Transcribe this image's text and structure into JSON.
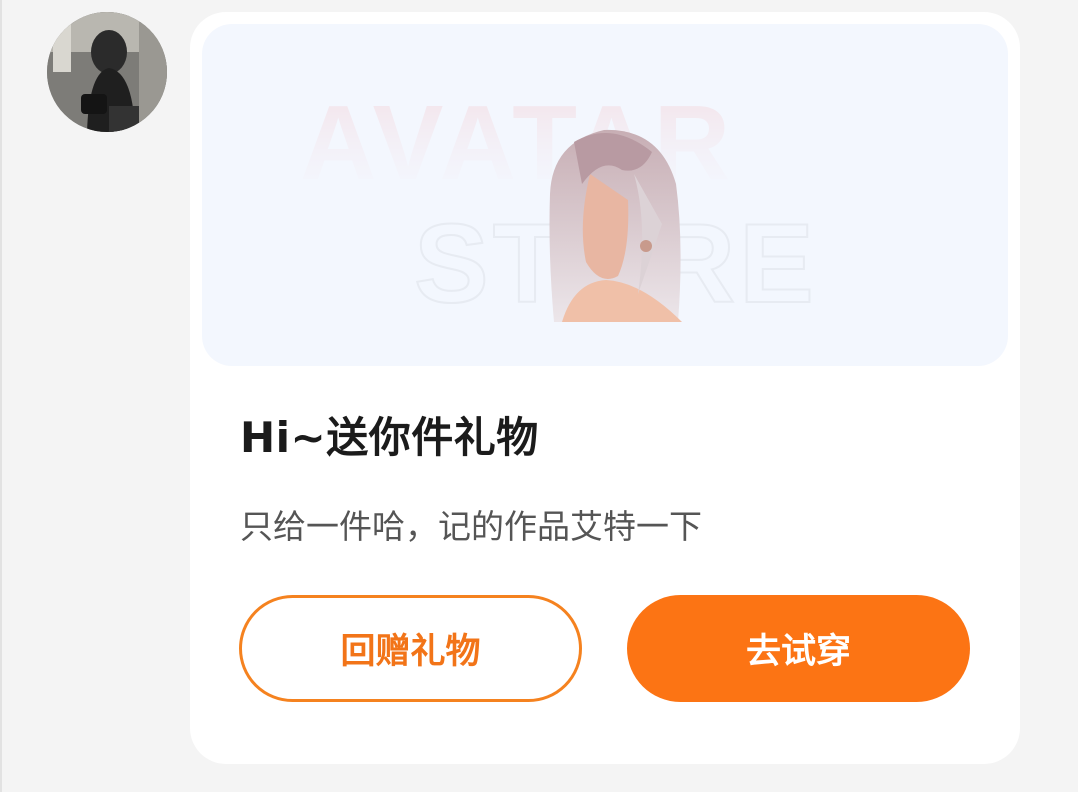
{
  "sender": {
    "avatar_icon": "user-avatar-photo"
  },
  "card": {
    "banner": {
      "watermark_line1": "AVATAR",
      "watermark_line2": "STORE"
    },
    "title": "Hi~送你件礼物",
    "message": "只给一件哈，记的作品艾特一下",
    "buttons": {
      "return_gift": "回赠礼物",
      "try_on": "去试穿"
    }
  },
  "colors": {
    "accent": "#fc7414",
    "outline": "#f5821f",
    "banner_bg": "#f3f7fe",
    "page_bg": "#f4f4f4"
  }
}
